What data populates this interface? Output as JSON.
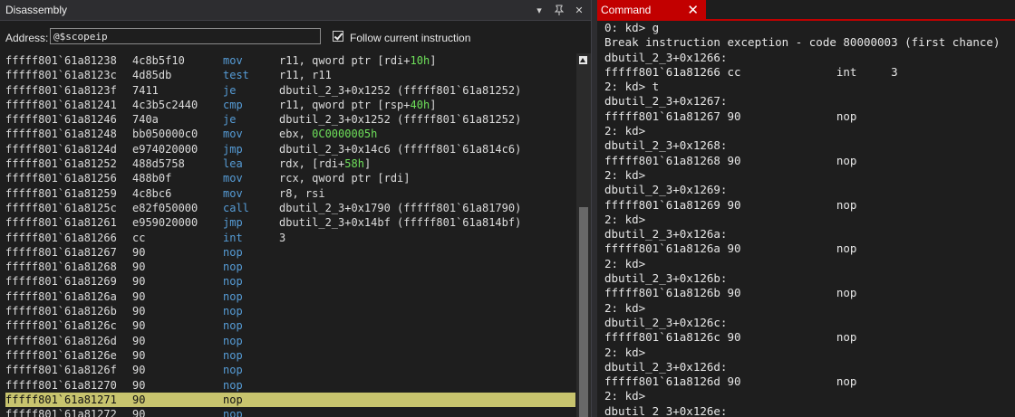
{
  "disassembly": {
    "title": "Disassembly",
    "address_label": "Address:",
    "address_value": "@$scopeip",
    "follow_label": "Follow current instruction",
    "rows": [
      {
        "addr": "fffff801`61a81238",
        "bytes": "4c8b5f10",
        "mn": "mov",
        "ops": "r11, qword ptr [rdi+",
        "imm": "10h",
        "tail": "]"
      },
      {
        "addr": "fffff801`61a8123c",
        "bytes": "4d85db",
        "mn": "test",
        "ops": "r11, r11",
        "imm": "",
        "tail": ""
      },
      {
        "addr": "fffff801`61a8123f",
        "bytes": "7411",
        "mn": "je",
        "ops": "dbutil_2_3+0x1252 (fffff801`61a81252)",
        "imm": "",
        "tail": ""
      },
      {
        "addr": "fffff801`61a81241",
        "bytes": "4c3b5c2440",
        "mn": "cmp",
        "ops": "r11, qword ptr [rsp+",
        "imm": "40h",
        "tail": "]"
      },
      {
        "addr": "fffff801`61a81246",
        "bytes": "740a",
        "mn": "je",
        "ops": "dbutil_2_3+0x1252 (fffff801`61a81252)",
        "imm": "",
        "tail": ""
      },
      {
        "addr": "fffff801`61a81248",
        "bytes": "bb050000c0",
        "mn": "mov",
        "ops": "ebx, ",
        "imm": "0C0000005h",
        "tail": ""
      },
      {
        "addr": "fffff801`61a8124d",
        "bytes": "e974020000",
        "mn": "jmp",
        "ops": "dbutil_2_3+0x14c6 (fffff801`61a814c6)",
        "imm": "",
        "tail": ""
      },
      {
        "addr": "fffff801`61a81252",
        "bytes": "488d5758",
        "mn": "lea",
        "ops": "rdx, [rdi+",
        "imm": "58h",
        "tail": "]"
      },
      {
        "addr": "fffff801`61a81256",
        "bytes": "488b0f",
        "mn": "mov",
        "ops": "rcx, qword ptr [rdi]",
        "imm": "",
        "tail": ""
      },
      {
        "addr": "fffff801`61a81259",
        "bytes": "4c8bc6",
        "mn": "mov",
        "ops": "r8, rsi",
        "imm": "",
        "tail": ""
      },
      {
        "addr": "fffff801`61a8125c",
        "bytes": "e82f050000",
        "mn": "call",
        "ops": "dbutil_2_3+0x1790 (fffff801`61a81790)",
        "imm": "",
        "tail": ""
      },
      {
        "addr": "fffff801`61a81261",
        "bytes": "e959020000",
        "mn": "jmp",
        "ops": "dbutil_2_3+0x14bf (fffff801`61a814bf)",
        "imm": "",
        "tail": ""
      },
      {
        "addr": "fffff801`61a81266",
        "bytes": "cc",
        "mn": "int",
        "ops": "3",
        "imm": "",
        "tail": ""
      },
      {
        "addr": "fffff801`61a81267",
        "bytes": "90",
        "mn": "nop",
        "ops": "",
        "imm": "",
        "tail": ""
      },
      {
        "addr": "fffff801`61a81268",
        "bytes": "90",
        "mn": "nop",
        "ops": "",
        "imm": "",
        "tail": ""
      },
      {
        "addr": "fffff801`61a81269",
        "bytes": "90",
        "mn": "nop",
        "ops": "",
        "imm": "",
        "tail": ""
      },
      {
        "addr": "fffff801`61a8126a",
        "bytes": "90",
        "mn": "nop",
        "ops": "",
        "imm": "",
        "tail": ""
      },
      {
        "addr": "fffff801`61a8126b",
        "bytes": "90",
        "mn": "nop",
        "ops": "",
        "imm": "",
        "tail": ""
      },
      {
        "addr": "fffff801`61a8126c",
        "bytes": "90",
        "mn": "nop",
        "ops": "",
        "imm": "",
        "tail": ""
      },
      {
        "addr": "fffff801`61a8126d",
        "bytes": "90",
        "mn": "nop",
        "ops": "",
        "imm": "",
        "tail": ""
      },
      {
        "addr": "fffff801`61a8126e",
        "bytes": "90",
        "mn": "nop",
        "ops": "",
        "imm": "",
        "tail": ""
      },
      {
        "addr": "fffff801`61a8126f",
        "bytes": "90",
        "mn": "nop",
        "ops": "",
        "imm": "",
        "tail": ""
      },
      {
        "addr": "fffff801`61a81270",
        "bytes": "90",
        "mn": "nop",
        "ops": "",
        "imm": "",
        "tail": ""
      },
      {
        "addr": "fffff801`61a81271",
        "bytes": "90",
        "mn": "nop",
        "ops": "",
        "imm": "",
        "tail": ""
      },
      {
        "addr": "fffff801`61a81272",
        "bytes": "90",
        "mn": "nop",
        "ops": "",
        "imm": "",
        "tail": ""
      }
    ]
  },
  "command": {
    "title": "Command",
    "lines": [
      "0: kd> g",
      "Break instruction exception - code 80000003 (first chance)",
      "dbutil_2_3+0x1266:",
      "fffff801`61a81266 cc              int     3",
      "2: kd> t",
      "dbutil_2_3+0x1267:",
      "fffff801`61a81267 90              nop",
      "2: kd>",
      "dbutil_2_3+0x1268:",
      "fffff801`61a81268 90              nop",
      "2: kd>",
      "dbutil_2_3+0x1269:",
      "fffff801`61a81269 90              nop",
      "2: kd>",
      "dbutil_2_3+0x126a:",
      "fffff801`61a8126a 90              nop",
      "2: kd>",
      "dbutil_2_3+0x126b:",
      "fffff801`61a8126b 90              nop",
      "2: kd>",
      "dbutil_2_3+0x126c:",
      "fffff801`61a8126c 90              nop",
      "2: kd>",
      "dbutil_2_3+0x126d:",
      "fffff801`61a8126d 90              nop",
      "2: kd>",
      "dbutil_2_3+0x126e:"
    ]
  }
}
